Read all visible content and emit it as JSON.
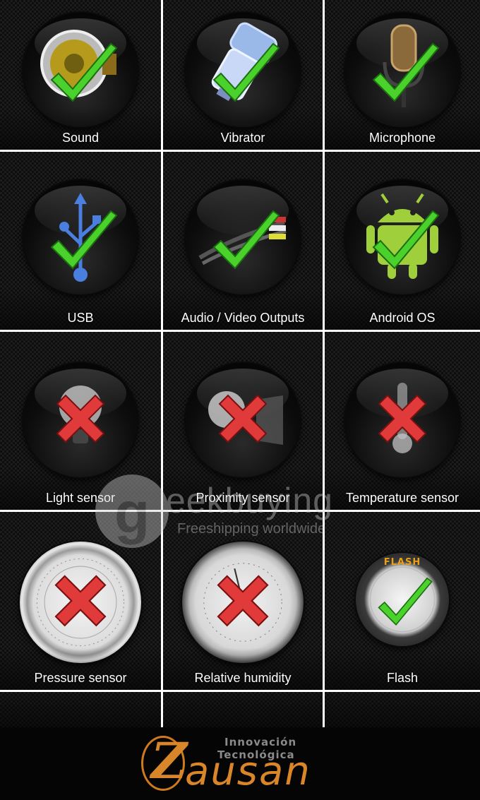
{
  "tiles": [
    {
      "label": "Sound",
      "status": "pass",
      "icon": "speaker-icon"
    },
    {
      "label": "Vibrator",
      "status": "pass",
      "icon": "vibrator-motor-icon"
    },
    {
      "label": "Microphone",
      "status": "pass",
      "icon": "microphone-icon"
    },
    {
      "label": "USB",
      "status": "pass",
      "icon": "usb-icon"
    },
    {
      "label": "Audio / Video Outputs",
      "status": "pass",
      "icon": "av-cable-icon"
    },
    {
      "label": "Android OS",
      "status": "pass",
      "icon": "android-robot-icon"
    },
    {
      "label": "Light sensor",
      "status": "fail",
      "icon": "light-bulb-icon"
    },
    {
      "label": "Proximity sensor",
      "status": "fail",
      "icon": "proximity-sensor-icon"
    },
    {
      "label": "Temperature sensor",
      "status": "fail",
      "icon": "thermometer-icon"
    },
    {
      "label": "Pressure sensor",
      "status": "fail",
      "icon": "barometer-gauge-icon"
    },
    {
      "label": "Relative humidity",
      "status": "fail",
      "icon": "hygrometer-gauge-icon"
    },
    {
      "label": "Flash",
      "status": "pass",
      "icon": "flash-icon",
      "badge": "FLASH"
    }
  ],
  "watermark": {
    "brand": "eekbuying",
    "letter": "g",
    "tagline": "Freeshipping worldwide"
  },
  "footer": {
    "logo_letter": "Z",
    "logo_word": "ausan",
    "tagline_line1": "Innovación",
    "tagline_line2": "Tecnológica"
  },
  "colors": {
    "check": "#4bd12c",
    "cross": "#e03a3a",
    "brand_orange": "#d9862a"
  }
}
